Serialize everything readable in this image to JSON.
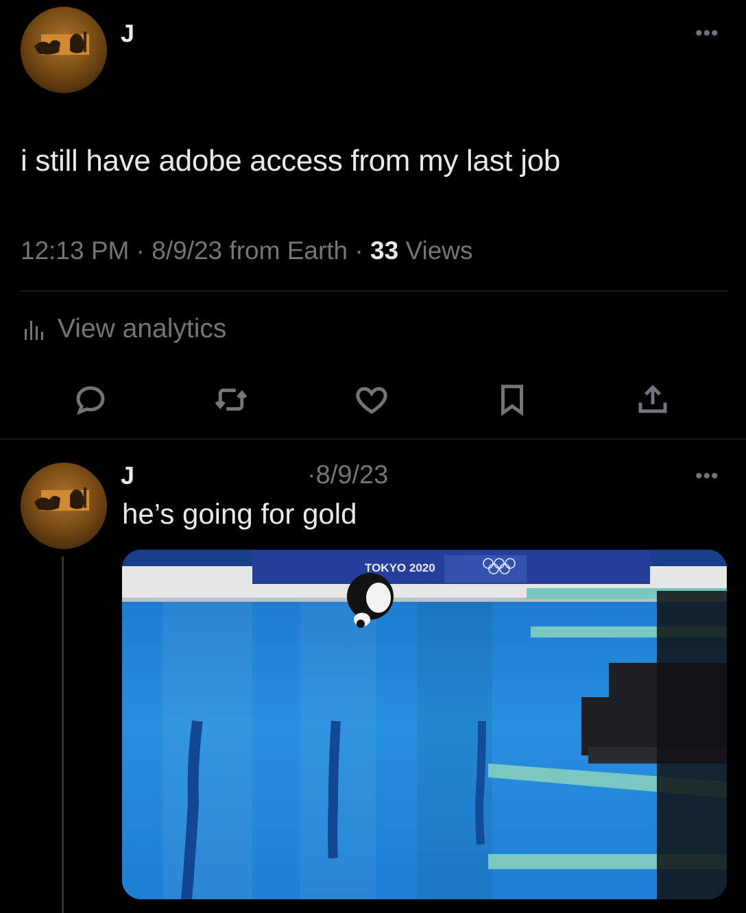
{
  "main_tweet": {
    "author_name": "J",
    "more_label": "•••",
    "text": "i still have adobe access from my last job",
    "time": "12:13 PM",
    "separator1": "·",
    "date": "8/9/23",
    "source": "from Earth",
    "separator2": "·",
    "views_count": "33",
    "views_label": "Views",
    "analytics_label": "View analytics",
    "actions": [
      "reply-icon",
      "retweet-icon",
      "like-icon",
      "bookmark-icon",
      "share-icon"
    ]
  },
  "reply": {
    "author_name": "J",
    "separator": "·",
    "date": "8/9/23",
    "more_label": "•••",
    "text": "he’s going for gold",
    "media": {
      "banner_text": "TOKYO 2020",
      "icon": "olympic-rings-icon"
    }
  },
  "colors": {
    "background": "#000000",
    "text_primary": "#e7e9ea",
    "text_secondary": "#71767b",
    "divider": "#2f3336",
    "pool_blue": "#1e84d8"
  }
}
